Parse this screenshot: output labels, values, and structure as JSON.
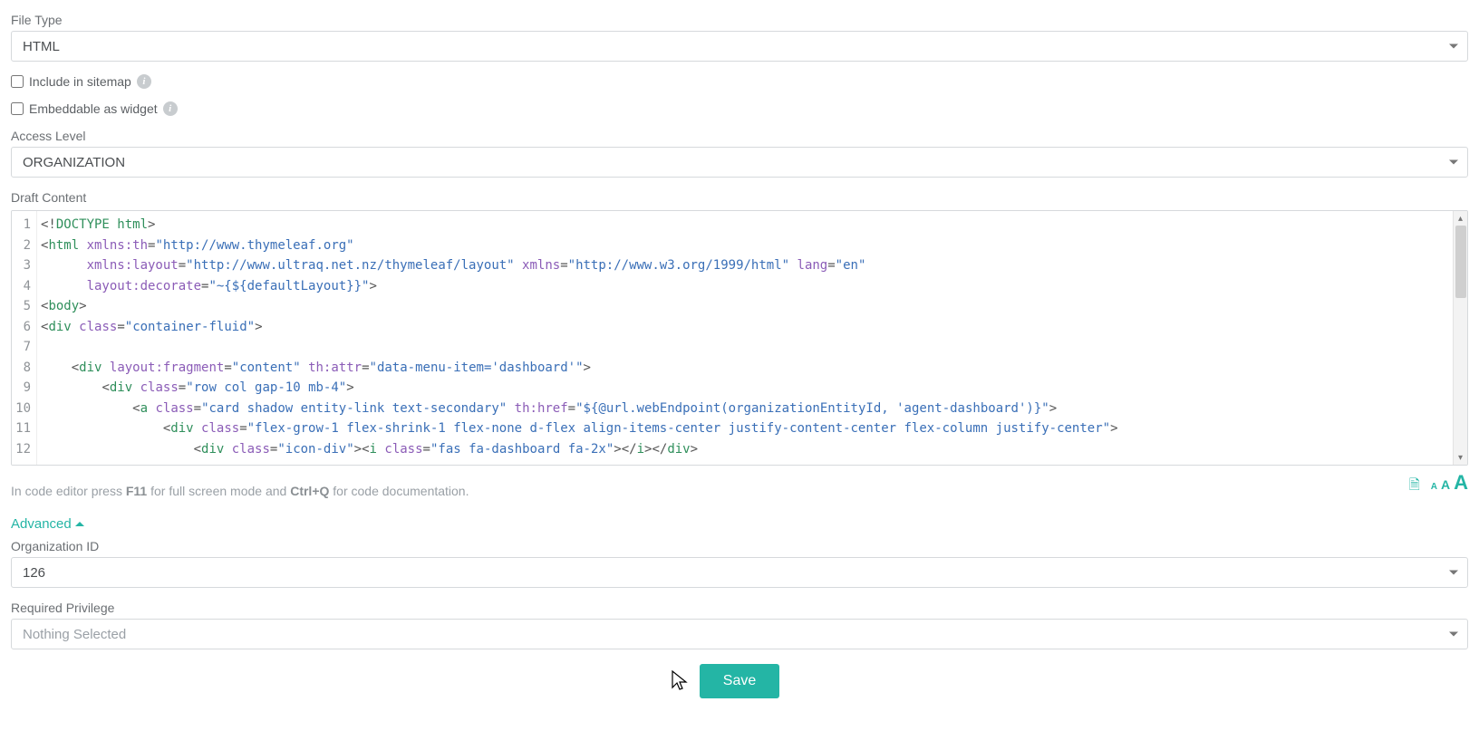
{
  "fileType": {
    "label": "File Type",
    "value": "HTML"
  },
  "sitemap": {
    "label": "Include in sitemap",
    "checked": false
  },
  "embed": {
    "label": "Embeddable as widget",
    "checked": false
  },
  "accessLevel": {
    "label": "Access Level",
    "value": "ORGANIZATION"
  },
  "draft": {
    "label": "Draft Content",
    "lines": [
      {
        "n": "1",
        "tokens": [
          [
            "punc",
            "<!"
          ],
          [
            "tag",
            "DOCTYPE html"
          ],
          [
            "punc",
            ">"
          ]
        ]
      },
      {
        "n": "2",
        "tokens": [
          [
            "punc",
            "<"
          ],
          [
            "tag",
            "html"
          ],
          [
            "plain",
            " "
          ],
          [
            "attr",
            "xmlns:th"
          ],
          [
            "punc",
            "="
          ],
          [
            "val",
            "\"http://www.thymeleaf.org\""
          ]
        ]
      },
      {
        "n": "3",
        "tokens": [
          [
            "plain",
            "      "
          ],
          [
            "attr",
            "xmlns:layout"
          ],
          [
            "punc",
            "="
          ],
          [
            "val",
            "\"http://www.ultraq.net.nz/thymeleaf/layout\""
          ],
          [
            "plain",
            " "
          ],
          [
            "attr",
            "xmlns"
          ],
          [
            "punc",
            "="
          ],
          [
            "val",
            "\"http://www.w3.org/1999/html\""
          ],
          [
            "plain",
            " "
          ],
          [
            "attr",
            "lang"
          ],
          [
            "punc",
            "="
          ],
          [
            "val",
            "\"en\""
          ]
        ]
      },
      {
        "n": "4",
        "tokens": [
          [
            "plain",
            "      "
          ],
          [
            "attr",
            "layout:decorate"
          ],
          [
            "punc",
            "="
          ],
          [
            "val",
            "\"~{${defaultLayout}}\""
          ],
          [
            "punc",
            ">"
          ]
        ]
      },
      {
        "n": "5",
        "tokens": [
          [
            "punc",
            "<"
          ],
          [
            "tag",
            "body"
          ],
          [
            "punc",
            ">"
          ]
        ]
      },
      {
        "n": "6",
        "tokens": [
          [
            "punc",
            "<"
          ],
          [
            "tag",
            "div"
          ],
          [
            "plain",
            " "
          ],
          [
            "attr",
            "class"
          ],
          [
            "punc",
            "="
          ],
          [
            "val",
            "\"container-fluid\""
          ],
          [
            "punc",
            ">"
          ]
        ]
      },
      {
        "n": "7",
        "tokens": []
      },
      {
        "n": "8",
        "tokens": [
          [
            "plain",
            "    "
          ],
          [
            "punc",
            "<"
          ],
          [
            "tag",
            "div"
          ],
          [
            "plain",
            " "
          ],
          [
            "attr",
            "layout:fragment"
          ],
          [
            "punc",
            "="
          ],
          [
            "val",
            "\"content\""
          ],
          [
            "plain",
            " "
          ],
          [
            "attr",
            "th:attr"
          ],
          [
            "punc",
            "="
          ],
          [
            "val",
            "\"data-menu-item='dashboard'\""
          ],
          [
            "punc",
            ">"
          ]
        ]
      },
      {
        "n": "9",
        "tokens": [
          [
            "plain",
            "        "
          ],
          [
            "punc",
            "<"
          ],
          [
            "tag",
            "div"
          ],
          [
            "plain",
            " "
          ],
          [
            "attr",
            "class"
          ],
          [
            "punc",
            "="
          ],
          [
            "val",
            "\"row col gap-10 mb-4\""
          ],
          [
            "punc",
            ">"
          ]
        ]
      },
      {
        "n": "10",
        "tokens": [
          [
            "plain",
            "            "
          ],
          [
            "punc",
            "<"
          ],
          [
            "tag",
            "a"
          ],
          [
            "plain",
            " "
          ],
          [
            "attr",
            "class"
          ],
          [
            "punc",
            "="
          ],
          [
            "val",
            "\"card shadow entity-link text-secondary\""
          ],
          [
            "plain",
            " "
          ],
          [
            "attr",
            "th:href"
          ],
          [
            "punc",
            "="
          ],
          [
            "val",
            "\"${@url.webEndpoint(organizationEntityId, 'agent-dashboard')}\""
          ],
          [
            "punc",
            ">"
          ]
        ]
      },
      {
        "n": "11",
        "tokens": [
          [
            "plain",
            "                "
          ],
          [
            "punc",
            "<"
          ],
          [
            "tag",
            "div"
          ],
          [
            "plain",
            " "
          ],
          [
            "attr",
            "class"
          ],
          [
            "punc",
            "="
          ],
          [
            "val",
            "\"flex-grow-1 flex-shrink-1 flex-none d-flex align-items-center justify-content-center flex-column justify-center\""
          ],
          [
            "punc",
            ">"
          ]
        ]
      },
      {
        "n": "12",
        "tokens": [
          [
            "plain",
            "                    "
          ],
          [
            "punc",
            "<"
          ],
          [
            "tag",
            "div"
          ],
          [
            "plain",
            " "
          ],
          [
            "attr",
            "class"
          ],
          [
            "punc",
            "="
          ],
          [
            "val",
            "\"icon-div\""
          ],
          [
            "punc",
            ">"
          ],
          [
            "punc",
            "<"
          ],
          [
            "tag",
            "i"
          ],
          [
            "plain",
            " "
          ],
          [
            "attr",
            "class"
          ],
          [
            "punc",
            "="
          ],
          [
            "val",
            "\"fas fa-dashboard fa-2x\""
          ],
          [
            "punc",
            ">"
          ],
          [
            "punc",
            "</"
          ],
          [
            "tag",
            "i"
          ],
          [
            "punc",
            ">"
          ],
          [
            "punc",
            "</"
          ],
          [
            "tag",
            "div"
          ],
          [
            "punc",
            ">"
          ]
        ]
      }
    ],
    "hint_pre": "In code editor press ",
    "hint_k1": "F11",
    "hint_mid": " for full screen mode and ",
    "hint_k2": "Ctrl+Q",
    "hint_post": " for code documentation."
  },
  "advanced": {
    "label": "Advanced"
  },
  "orgId": {
    "label": "Organization ID",
    "value": "126"
  },
  "reqPriv": {
    "label": "Required Privilege",
    "value": "Nothing Selected"
  },
  "save": {
    "label": "Save"
  },
  "fontSizer": "A"
}
